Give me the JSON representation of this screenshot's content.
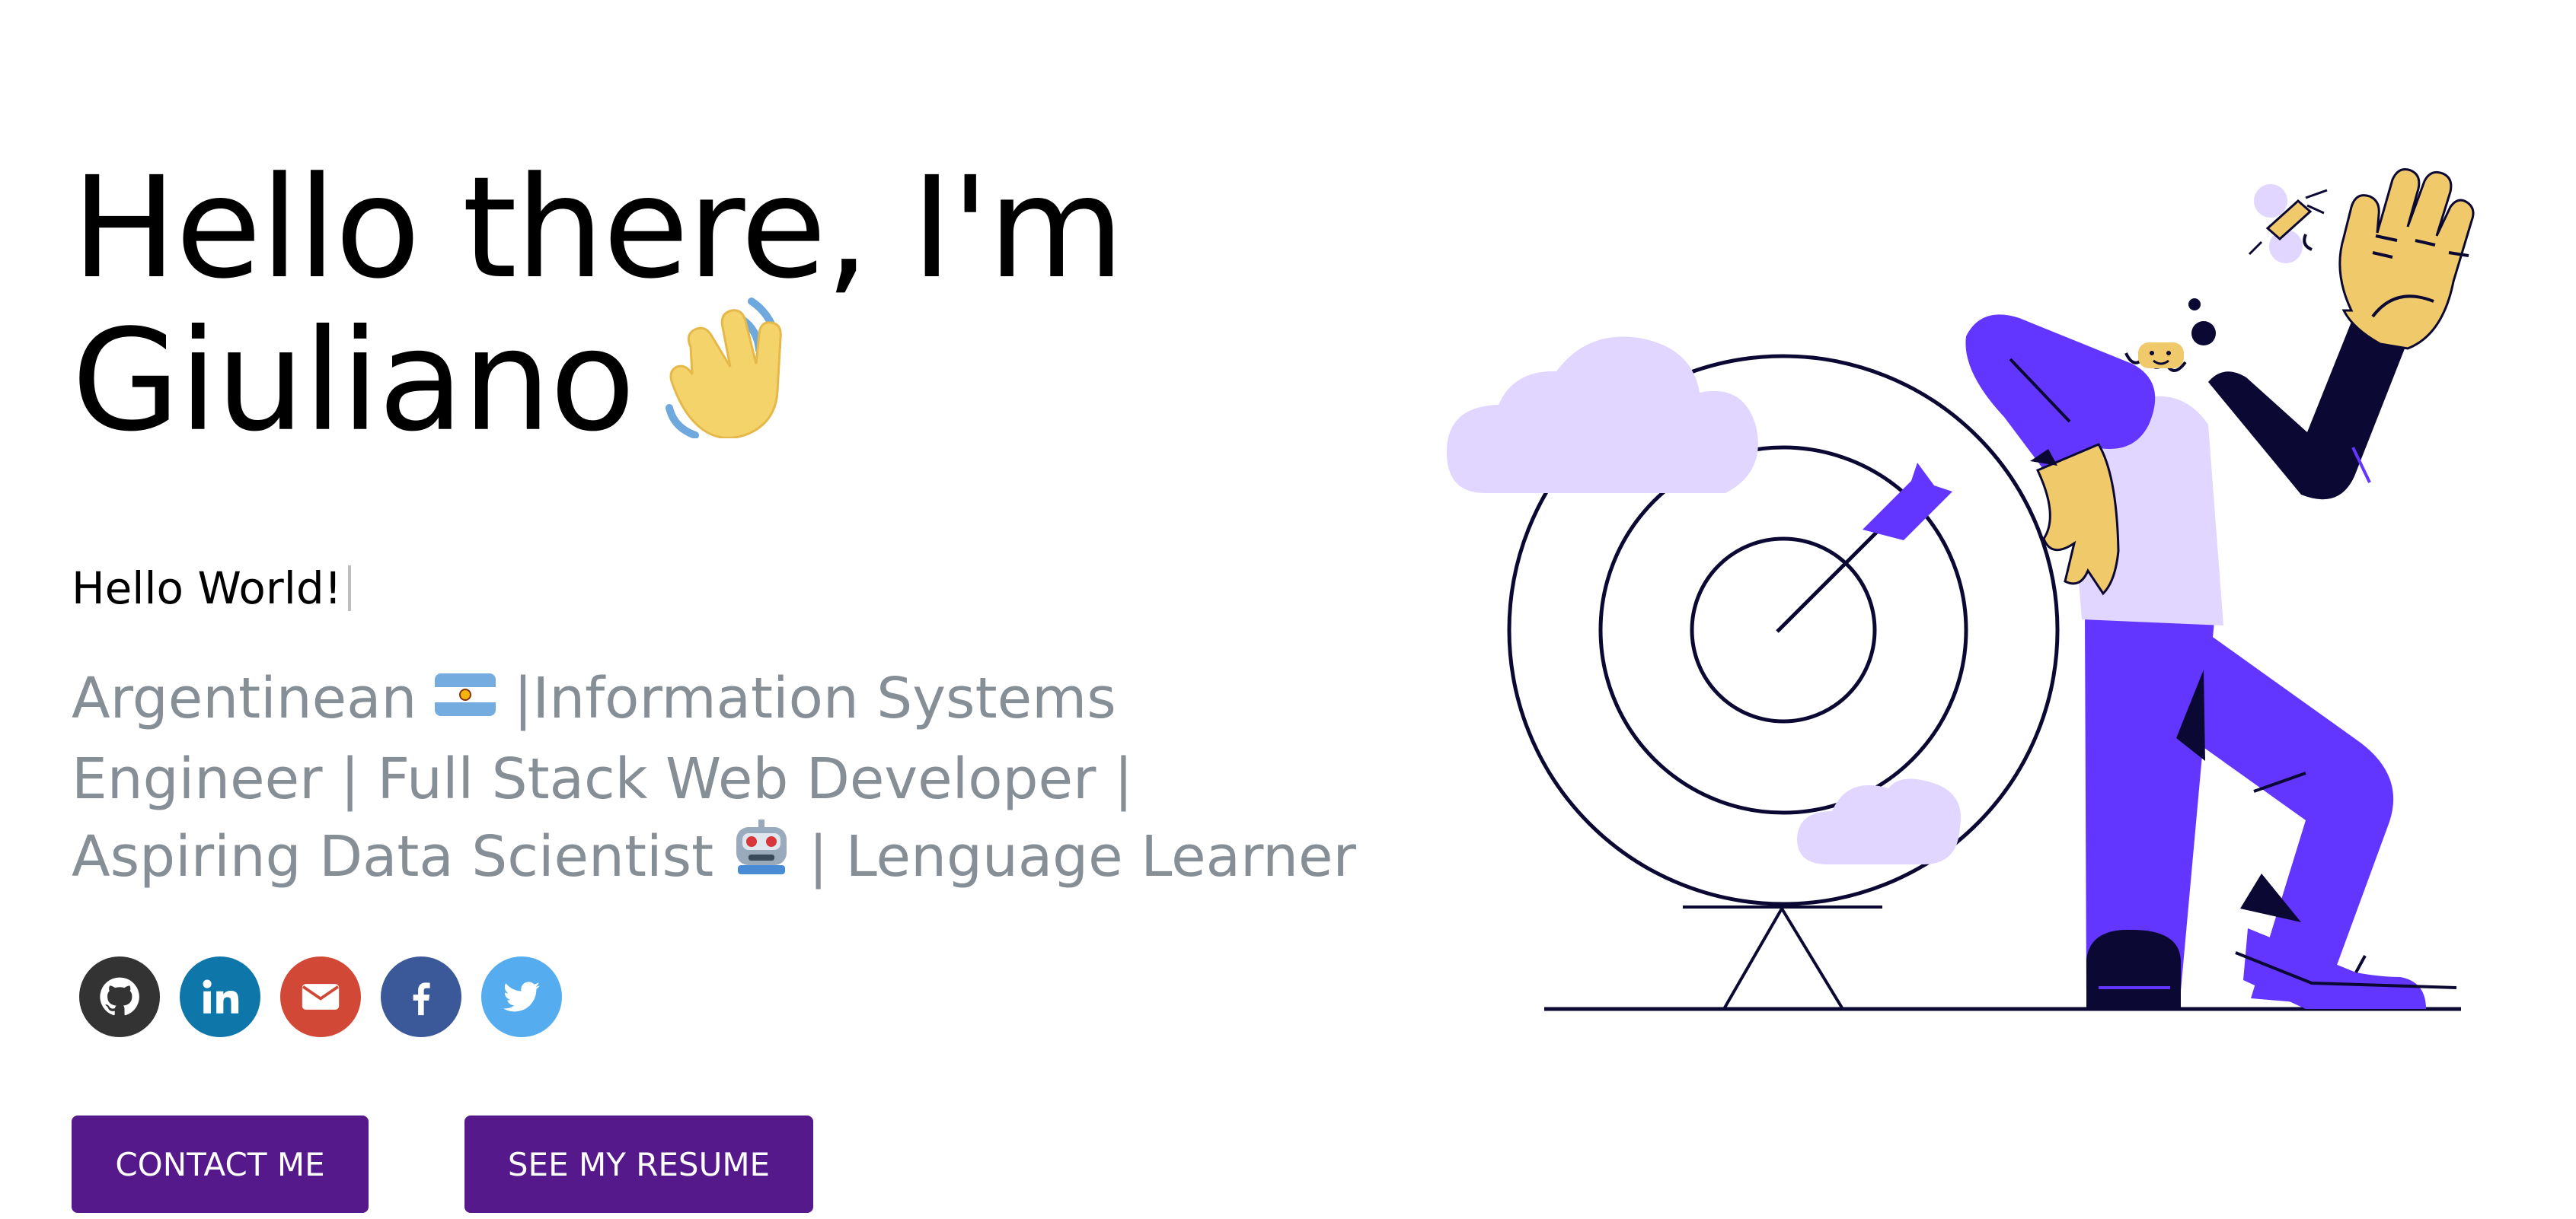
{
  "greeting": {
    "line1": "Hello there, I'm",
    "line2": "Giuliano",
    "emoji_icon": "waving-hand-icon"
  },
  "typed_text": "Hello World!",
  "bio": {
    "row1_a": "Argentinean",
    "row1_b": "|Information Systems",
    "row2": "Engineer | Full Stack Web Developer |",
    "row3_a": "Aspiring Data Scientist",
    "row3_b": "| Lenguage Learner",
    "flag_icon": "argentina-flag-icon",
    "robot_icon": "robot-icon"
  },
  "socials": [
    {
      "name": "github",
      "icon": "github-icon",
      "color": "#333333"
    },
    {
      "name": "linkedin",
      "icon": "linkedin-icon",
      "color": "#0e76a8"
    },
    {
      "name": "email",
      "icon": "mail-icon",
      "color": "#d14836"
    },
    {
      "name": "facebook",
      "icon": "facebook-icon",
      "color": "#3b5998"
    },
    {
      "name": "twitter",
      "icon": "twitter-icon",
      "color": "#55acee"
    }
  ],
  "buttons": {
    "contact": "CONTACT ME",
    "resume": "SEE MY RESUME"
  },
  "colors": {
    "accent": "#55198b",
    "bio_text": "#868e96",
    "illustration_purple": "#6236ff",
    "illustration_lavender": "#e0d6ff",
    "illustration_yellow": "#f0c96b",
    "illustration_navy": "#0b0933"
  }
}
